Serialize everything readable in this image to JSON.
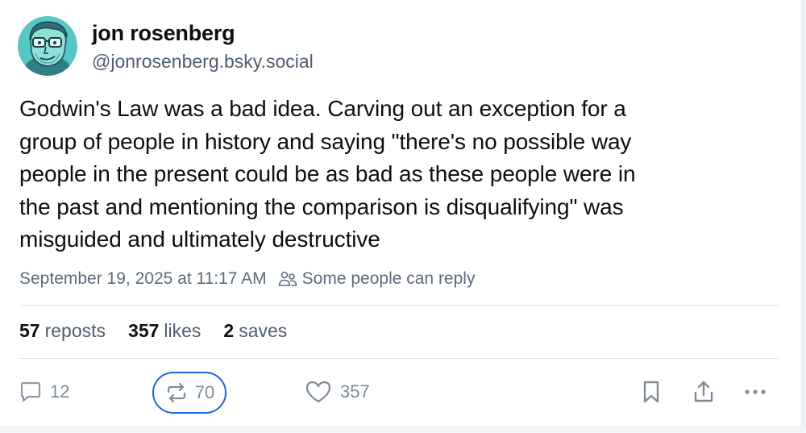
{
  "author": {
    "name": "jon rosenberg",
    "handle": "@jonrosenberg.bsky.social",
    "avatar_icon": "cartoon-avatar-icon"
  },
  "post": {
    "text": "Godwin's Law was a bad idea. Carving out an exception for a\ngroup of people in history and saying \"there's no possible way\npeople in the present could be as bad as these people were in\nthe past and mentioning the comparison is disqualifying\" was\nmisguided and ultimately destructive"
  },
  "meta": {
    "timestamp": "September 19, 2025 at 11:17 AM",
    "reply_setting": "Some people can reply",
    "reply_setting_icon": "people-icon"
  },
  "stats": {
    "reposts": {
      "count": "57",
      "label": "reposts"
    },
    "likes": {
      "count": "357",
      "label": "likes"
    },
    "saves": {
      "count": "2",
      "label": "saves"
    }
  },
  "actions": {
    "reply": {
      "count": "12",
      "icon": "reply-icon"
    },
    "repost": {
      "count": "70",
      "icon": "repost-icon"
    },
    "like": {
      "count": "357",
      "icon": "heart-icon"
    },
    "bookmark": {
      "icon": "bookmark-icon"
    },
    "share": {
      "icon": "share-icon"
    },
    "more": {
      "icon": "more-icon"
    }
  },
  "colors": {
    "text": "#0b0f14",
    "muted": "#5b6b7b",
    "action_gray": "#7d8b99",
    "highlight_ring": "#1668d6",
    "divider": "#dfe5eb",
    "avatar_bg": "#56c7c3"
  }
}
